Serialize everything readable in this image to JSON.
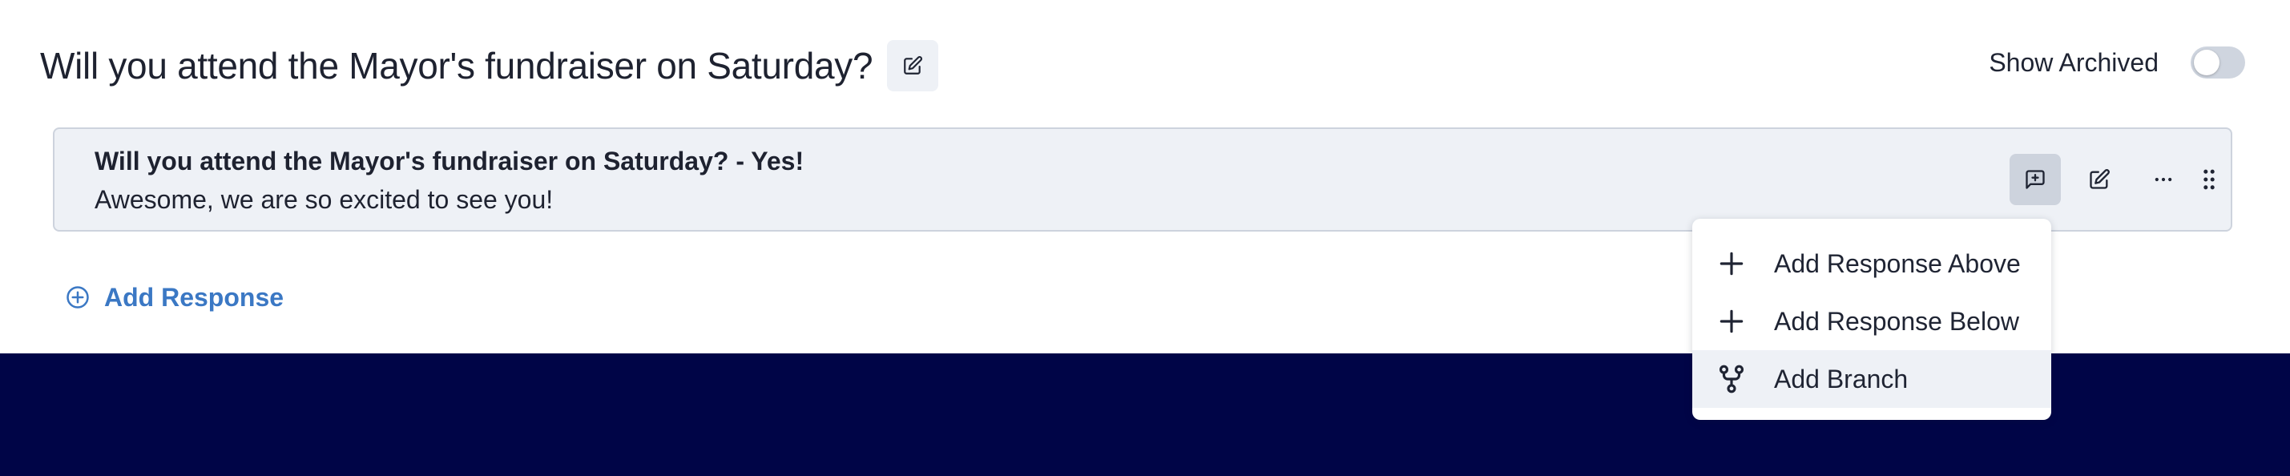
{
  "header": {
    "title": "Will you attend the Mayor's fundraiser on Saturday?",
    "edit_icon": "edit-icon"
  },
  "archived": {
    "label": "Show Archived",
    "toggle_on": false
  },
  "response": {
    "title": "Will you attend the Mayor's fundraiser on Saturday? - Yes!",
    "body": "Awesome, we are so excited to see you!",
    "actions": [
      {
        "icon": "message-plus-icon",
        "active": true
      },
      {
        "icon": "edit-icon",
        "active": false
      },
      {
        "icon": "more-icon",
        "active": false
      },
      {
        "icon": "drag-handle-icon",
        "active": false
      }
    ]
  },
  "add_response": {
    "label": "Add Response",
    "icon": "plus-circle-icon"
  },
  "menu": {
    "items": [
      {
        "label": "Add Response Above",
        "icon": "plus-icon"
      },
      {
        "label": "Add Response Below",
        "icon": "plus-icon"
      },
      {
        "label": "Add Branch",
        "icon": "branch-icon",
        "hover": true
      }
    ]
  },
  "colors": {
    "accent": "#3b78c4",
    "card_bg": "#eef1f6",
    "footer_bg": "#000547"
  }
}
